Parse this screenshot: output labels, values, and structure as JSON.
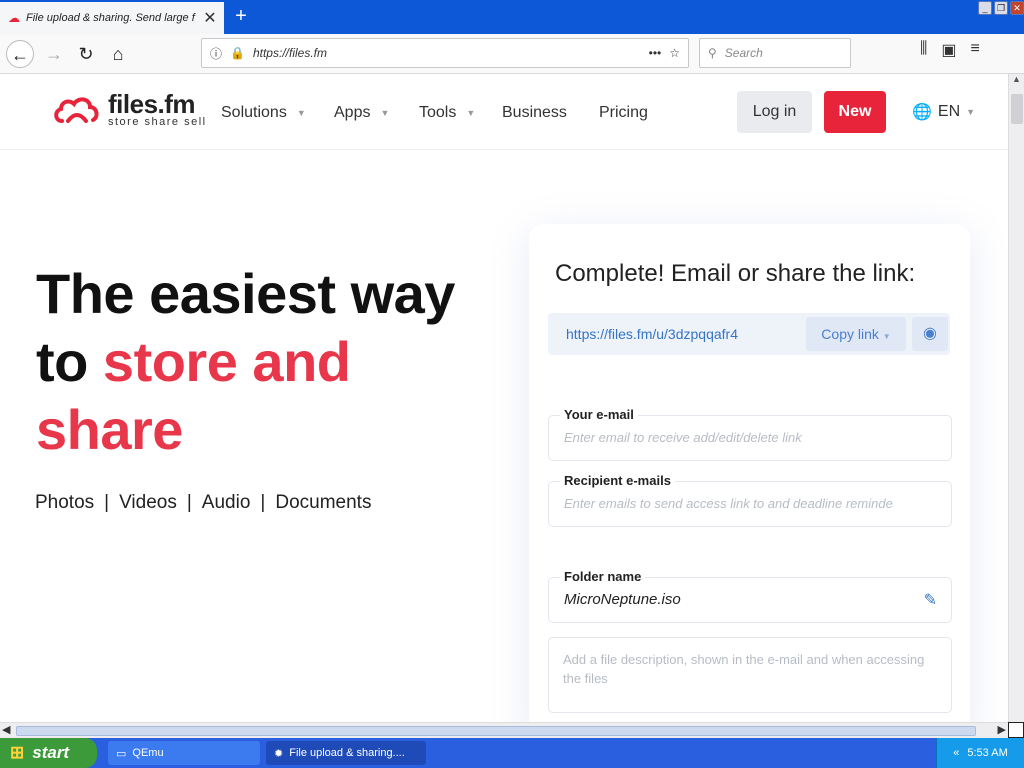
{
  "browser": {
    "tab_title": "File upload & sharing. Send large f",
    "url": "https://files.fm",
    "search_placeholder": "Search",
    "window_buttons": [
      "minimize",
      "restore",
      "close"
    ]
  },
  "site": {
    "logo_name": "files.fm",
    "logo_tagline": "store  share  sell",
    "nav": [
      {
        "label": "Solutions"
      },
      {
        "label": "Apps"
      },
      {
        "label": "Tools"
      },
      {
        "label": "Business"
      },
      {
        "label": "Pricing"
      }
    ],
    "login_label": "Log in",
    "new_label": "New",
    "lang_label": "EN",
    "accent": "#e8243a"
  },
  "hero": {
    "line1": "The easiest way",
    "line2_prefix": "to ",
    "line2_red": "store and",
    "line3_red": "share",
    "categories": [
      "Photos",
      "|",
      "Videos",
      "|",
      "Audio",
      "|",
      "Documents"
    ]
  },
  "share_card": {
    "title": "Complete! Email or share the link:",
    "link": "https://files.fm/u/3dzpqqafr4",
    "copy_label": "Copy link",
    "email_label": "Your e-mail",
    "email_placeholder": "Enter email to receive add/edit/delete link",
    "recipient_label": "Recipient e-mails",
    "recipient_placeholder": "Enter emails to send access link to and deadline reminde",
    "folder_label": "Folder name",
    "folder_value": "MicroNeptune.iso",
    "description_placeholder": "Add a file description, shown in the e-mail and when accessing the files"
  },
  "taskbar": {
    "start_label": "start",
    "tasks": [
      {
        "label": "QEmu"
      },
      {
        "label": "File upload & sharing...."
      }
    ],
    "clock": "5:53 AM"
  }
}
